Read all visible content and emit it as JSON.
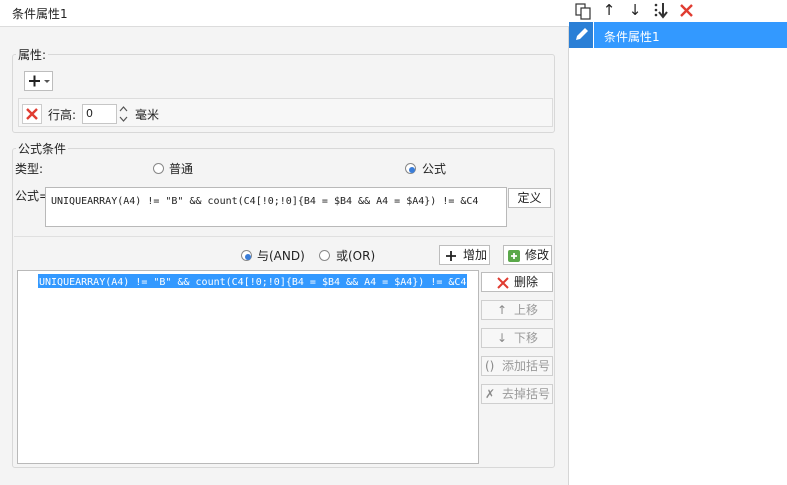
{
  "window": {
    "title": "条件属性1"
  },
  "properties": {
    "legend": "属性:",
    "add_icon": "plus-icon",
    "row": {
      "label": "行高:",
      "value": "0",
      "unit": "毫米"
    }
  },
  "formula_condition": {
    "legend": "公式条件",
    "type_label": "类型:",
    "type_options": [
      "普通",
      "公式"
    ],
    "selected_type": "公式",
    "formula_label": "公式=",
    "formula_value": "UNIQUEARRAY(A4) != \"B\" && count(C4[!0;!0]{B4 = $B4 && A4 = $A4}) != &C4",
    "define_button": "定义",
    "logic_and": "与(AND)",
    "logic_or": "或(OR)",
    "selected_logic": "与(AND)",
    "add_button": "增加",
    "modify_button": "修改",
    "conditions": [
      "UNIQUEARRAY(A4) != \"B\" && count(C4[!0;!0]{B4 = $B4 && A4 = $A4}) != &C4"
    ],
    "side_buttons": {
      "delete": "删除",
      "move_up": "上移",
      "move_down": "下移",
      "add_bracket": "添加括号",
      "remove_bracket": "去掉括号"
    }
  },
  "right_panel": {
    "toolbar_icons": [
      "copy-icon",
      "arrow-up-icon",
      "arrow-down-icon",
      "move-bottom-icon",
      "delete-icon"
    ],
    "items": [
      {
        "label": "条件属性1",
        "selected": true
      }
    ]
  },
  "colors": {
    "selection": "#3399ff",
    "delete_red": "#e03c31",
    "panel_bg": "#f4f4f4"
  }
}
